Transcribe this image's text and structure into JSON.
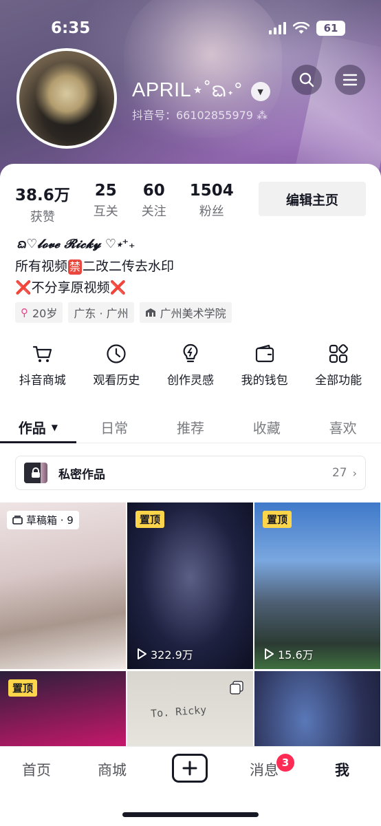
{
  "status_bar": {
    "time": "6:35",
    "battery": "61"
  },
  "profile": {
    "name": "APRIL⋆˚ᨳ˖°",
    "douyin_id": "抖音号：66102855979 ⁂",
    "stats": [
      {
        "num": "38.6万",
        "label": "获赞"
      },
      {
        "num": "25",
        "label": "互关"
      },
      {
        "num": "60",
        "label": "关注"
      },
      {
        "num": "1504",
        "label": "粉丝"
      }
    ],
    "edit_label": "编辑主页",
    "signature": "ᨳ♡𝓵𝓸𝓿𝓮 𝓡𝓲𝓬𝓴𝔂 ♡⋆⁺₊",
    "bio_line1_a": "所有视频",
    "bio_forbid": "禁",
    "bio_line1_b": "二改二传去水印",
    "bio_line2_cross": "❌",
    "bio_line2_text": "不分享原视频",
    "tags": {
      "age": "20岁",
      "location": "广东 · 广州",
      "school": "广州美术学院"
    }
  },
  "shortcuts": [
    {
      "label": "抖音商城",
      "icon": "cart-icon"
    },
    {
      "label": "观看历史",
      "icon": "clock-icon"
    },
    {
      "label": "创作灵感",
      "icon": "bulb-icon"
    },
    {
      "label": "我的钱包",
      "icon": "wallet-icon"
    },
    {
      "label": "全部功能",
      "icon": "grid-icon"
    }
  ],
  "tabs": [
    "作品",
    "日常",
    "推荐",
    "收藏",
    "喜欢"
  ],
  "private_works": {
    "label": "私密作品",
    "count": "27"
  },
  "grid": {
    "draft_label": "草稿箱 · 9",
    "pinned_label": "置顶",
    "plays_2": "322.9万",
    "plays_3": "15.6万",
    "note_text": "To. Ricky"
  },
  "bottom_nav": {
    "home": "首页",
    "mall": "商城",
    "messages": "消息",
    "messages_badge": "3",
    "me": "我"
  }
}
